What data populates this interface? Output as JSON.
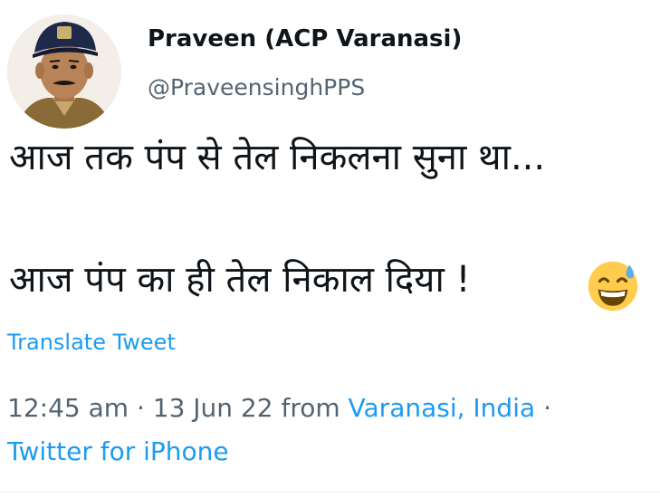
{
  "author": {
    "display_name": "Praveen (ACP Varanasi)",
    "handle": "@PraveensinghPPS"
  },
  "tweet": {
    "line1": "आज तक पंप से तेल निकलना सुना था...",
    "line2": "आज पंप का ही तेल निकाल दिया !",
    "emoji_icon": "grinning-face-with-sweat-icon"
  },
  "translate_label": "Translate Tweet",
  "meta": {
    "time": "12:45 am",
    "separator": "·",
    "date": "13 Jun 22",
    "from_label": "from",
    "location": "Varanasi, India",
    "source": "Twitter for iPhone"
  },
  "colors": {
    "link": "#1d9bf0",
    "secondary": "#536471",
    "primary": "#0f1419"
  }
}
